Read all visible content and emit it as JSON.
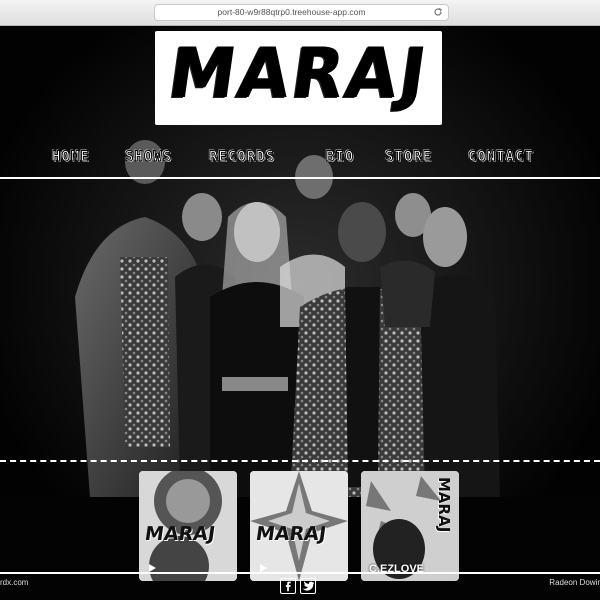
{
  "browser": {
    "url": "port-80-w9r88qtrp0.treehouse-app.com",
    "reload_icon": "reload-icon"
  },
  "site": {
    "logo": "MARAJ"
  },
  "nav": {
    "items": [
      {
        "label": "HOME"
      },
      {
        "label": "SHOWS"
      },
      {
        "label": "RECORDS"
      },
      {
        "label": "BIO"
      },
      {
        "label": "STORE"
      },
      {
        "label": "CONTACT"
      }
    ]
  },
  "albums": [
    {
      "title": "MARAJ",
      "subtitle": ""
    },
    {
      "title": "MARAJ",
      "subtitle": ""
    },
    {
      "title": "MARAJ",
      "subtitle": "C.EZLOVE"
    }
  ],
  "footer": {
    "left_text": "rdx.com",
    "right_text": "Radeon Dowir",
    "social_icons": [
      "facebook-icon",
      "twitter-icon"
    ]
  },
  "colors": {
    "background": "#000000",
    "accent": "#ffffff"
  }
}
